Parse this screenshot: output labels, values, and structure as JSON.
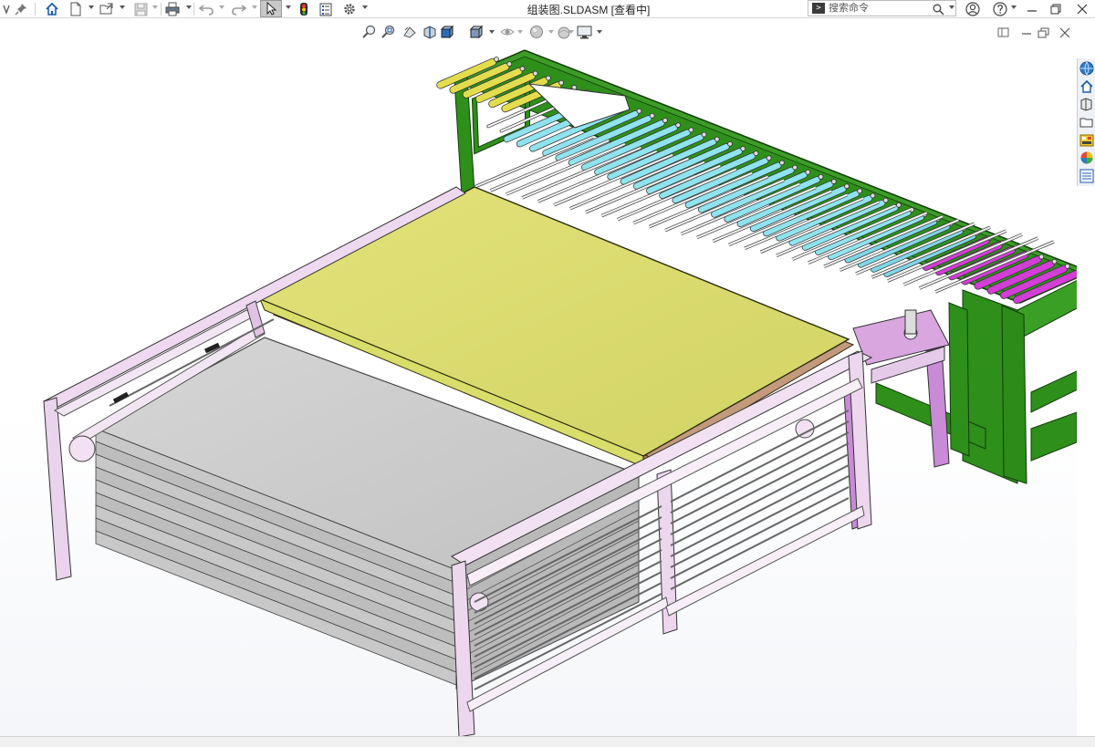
{
  "window": {
    "title": "组装图.SLDASM [查看中]"
  },
  "toolbar": {
    "items": [
      "pin-icon",
      "home-icon",
      "new-document-icon",
      "open-icon",
      "save-icon",
      "print-icon",
      "undo-icon",
      "redo-icon",
      "select-icon",
      "rebuild-icon",
      "file-properties-icon",
      "options-icon"
    ]
  },
  "search": {
    "placeholder": "搜索命令"
  },
  "hud_toolbar": {
    "items": [
      "zoom-to-fit-icon",
      "zoom-to-area-icon",
      "previous-view-icon",
      "section-view-icon",
      "view-orientation-icon",
      "display-style-icon",
      "hide-show-items-icon",
      "edit-appearance-icon",
      "apply-scene-icon",
      "view-settings-icon"
    ]
  },
  "task_pane": {
    "tabs": [
      "solidworks-resources-icon",
      "design-library-icon",
      "file-explorer-icon",
      "view-palette-icon",
      "appearances-icon",
      "custom-properties-icon"
    ]
  },
  "colors": {
    "frame_green": "#2e8f1a",
    "roller_cyan": "#8fe3ee",
    "roller_yellow": "#e3dd4e",
    "roller_magenta": "#d23ed6",
    "plate_yellow": "#d7d86a",
    "stack_gray": "#c9c9c9",
    "frame_pink": "#e9d4ea"
  }
}
